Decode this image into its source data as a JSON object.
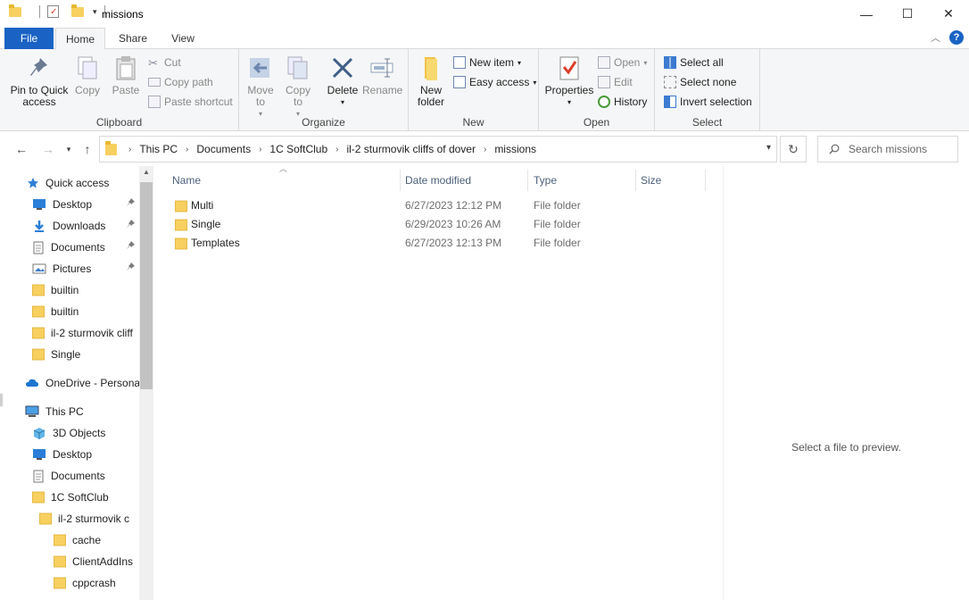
{
  "window": {
    "title": "missions",
    "controls": {
      "minimize": "—",
      "maximize": "☐",
      "close": "✕"
    }
  },
  "ribbon_tabs": [
    "File",
    "Home",
    "Share",
    "View"
  ],
  "ribbon": {
    "clipboard": {
      "label": "Clipboard",
      "pin": "Pin to Quick access",
      "copy": "Copy",
      "paste": "Paste",
      "cut": "Cut",
      "copy_path": "Copy path",
      "paste_shortcut": "Paste shortcut"
    },
    "organize": {
      "label": "Organize",
      "move_to": "Move to",
      "copy_to": "Copy to",
      "delete": "Delete",
      "rename": "Rename"
    },
    "new": {
      "label": "New",
      "new_folder": "New folder",
      "new_item": "New item",
      "easy_access": "Easy access"
    },
    "open": {
      "label": "Open",
      "properties": "Properties",
      "open": "Open",
      "edit": "Edit",
      "history": "History"
    },
    "select": {
      "label": "Select",
      "select_all": "Select all",
      "select_none": "Select none",
      "invert": "Invert selection"
    }
  },
  "address": {
    "crumbs": [
      "This PC",
      "Documents",
      "1C SoftClub",
      "il-2 sturmovik cliffs of dover",
      "missions"
    ]
  },
  "search": {
    "placeholder": "Search missions"
  },
  "nav_pane": [
    {
      "label": "Quick access",
      "icon": "star-icon",
      "indent": 0,
      "pinned": false
    },
    {
      "label": "Desktop",
      "icon": "desktop-icon",
      "indent": 1,
      "pinned": true
    },
    {
      "label": "Downloads",
      "icon": "download-icon",
      "indent": 1,
      "pinned": true
    },
    {
      "label": "Documents",
      "icon": "document-icon",
      "indent": 1,
      "pinned": true
    },
    {
      "label": "Pictures",
      "icon": "picture-icon",
      "indent": 1,
      "pinned": true
    },
    {
      "label": "builtin",
      "icon": "folder-icon",
      "indent": 1,
      "pinned": false
    },
    {
      "label": "builtin",
      "icon": "folder-icon",
      "indent": 1,
      "pinned": false
    },
    {
      "label": "il-2 sturmovik cliff",
      "icon": "folder-icon",
      "indent": 1,
      "pinned": false
    },
    {
      "label": "Single",
      "icon": "folder-icon",
      "indent": 1,
      "pinned": false
    },
    {
      "label": "OneDrive - Personal",
      "icon": "cloud-icon",
      "indent": 0,
      "pinned": false
    },
    {
      "label": "This PC",
      "icon": "computer-icon",
      "indent": 0,
      "pinned": false
    },
    {
      "label": "3D Objects",
      "icon": "cube-icon",
      "indent": 1,
      "pinned": false
    },
    {
      "label": "Desktop",
      "icon": "desktop-icon",
      "indent": 1,
      "pinned": false
    },
    {
      "label": "Documents",
      "icon": "document-icon",
      "indent": 1,
      "pinned": false
    },
    {
      "label": "1C SoftClub",
      "icon": "folder-icon",
      "indent": 2,
      "pinned": false
    },
    {
      "label": "il-2 sturmovik c",
      "icon": "folder-icon",
      "indent": 3,
      "pinned": false
    },
    {
      "label": "cache",
      "icon": "folder-icon",
      "indent": 4,
      "pinned": false
    },
    {
      "label": "ClientAddIns",
      "icon": "folder-icon",
      "indent": 4,
      "pinned": false
    },
    {
      "label": "cppcrash",
      "icon": "folder-icon",
      "indent": 4,
      "pinned": false
    }
  ],
  "columns": [
    "Name",
    "Date modified",
    "Type",
    "Size"
  ],
  "files": [
    {
      "name": "Multi",
      "date": "6/27/2023 12:12 PM",
      "type": "File folder",
      "size": ""
    },
    {
      "name": "Single",
      "date": "6/29/2023 10:26 AM",
      "type": "File folder",
      "size": ""
    },
    {
      "name": "Templates",
      "date": "6/27/2023 12:13 PM",
      "type": "File folder",
      "size": ""
    }
  ],
  "preview": {
    "message": "Select a file to preview."
  },
  "colors": {
    "accent": "#1a63c4",
    "folder": "#f7d060",
    "ribbon_bg": "#f5f6f7"
  }
}
